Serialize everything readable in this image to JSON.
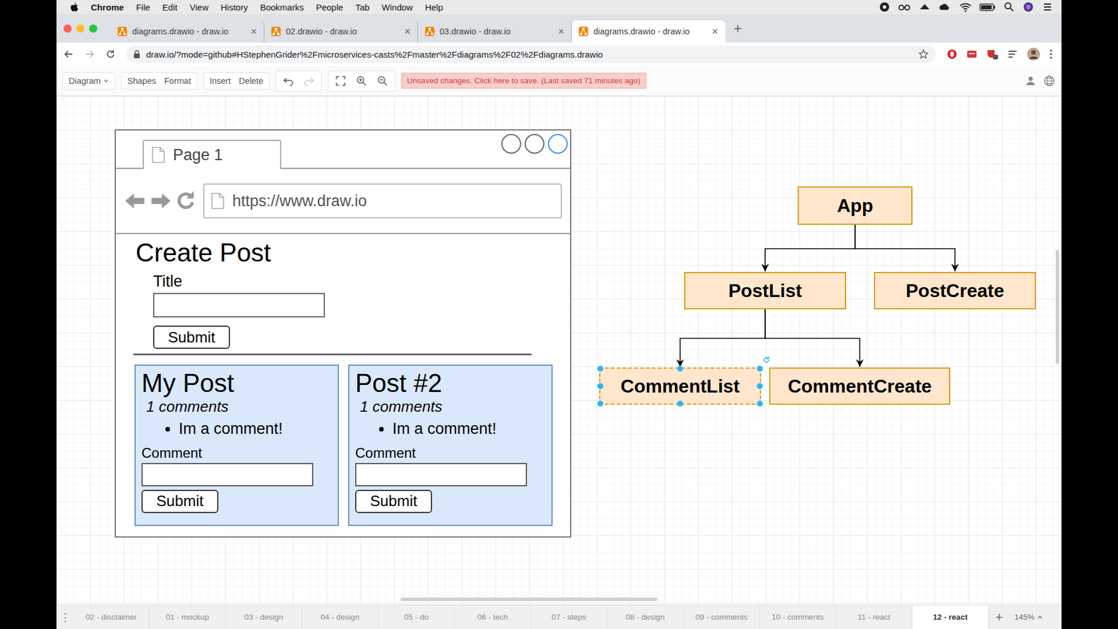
{
  "menubar": {
    "app": "Chrome",
    "items": [
      "File",
      "Edit",
      "View",
      "History",
      "Bookmarks",
      "People",
      "Tab",
      "Window",
      "Help"
    ]
  },
  "browser_tabs": [
    {
      "title": "diagrams.drawio - draw.io",
      "close": "×",
      "selected": false
    },
    {
      "title": "02.drawio - draw.io",
      "close": "×",
      "selected": false
    },
    {
      "title": "03.drawio - draw.io",
      "close": "×",
      "selected": false
    },
    {
      "title": "diagrams.drawio - draw.io",
      "close": "×",
      "selected": true
    }
  ],
  "new_tab": "+",
  "address_bar": {
    "url": "draw.io/?mode=github#HStephenGrider%2Fmicroservices-casts%2Fmaster%2Fdiagrams%2F02%2Fdiagrams.drawio"
  },
  "toolbar": {
    "groups": [
      [
        {
          "label": "Diagram",
          "dropdown": true
        }
      ],
      [
        {
          "label": "Shapes",
          "dropdown": false
        },
        {
          "label": "Format",
          "dropdown": false
        }
      ],
      [
        {
          "label": "Insert",
          "dropdown": false
        },
        {
          "label": "Delete",
          "dropdown": false
        }
      ]
    ],
    "banner": "Unsaved changes. Click here to save. (Last saved 71 minutes ago)"
  },
  "mockup": {
    "tab": "Page 1",
    "window_buttons": [
      {
        "highlighted": false
      },
      {
        "highlighted": false
      },
      {
        "highlighted": true
      }
    ],
    "url": "https://www.draw.io",
    "heading": "Create Post",
    "field_label": "Title",
    "field_value": "",
    "button": "Submit",
    "posts": [
      {
        "title": "My Post",
        "comment_count": "1 comments",
        "comments": [
          "Im a comment!"
        ],
        "field_label": "Comment",
        "field_value": "",
        "button": "Submit"
      },
      {
        "title": "Post #2",
        "comment_count": "1 comments",
        "comments": [
          "Im a comment!"
        ],
        "field_label": "Comment",
        "field_value": "",
        "button": "Submit"
      }
    ]
  },
  "diagram": {
    "nodes": [
      {
        "label": "App",
        "selected": false
      },
      {
        "label": "PostList",
        "selected": false
      },
      {
        "label": "PostCreate",
        "selected": false
      },
      {
        "label": "CommentList",
        "selected": true
      },
      {
        "label": "CommentCreate",
        "selected": false
      }
    ],
    "edges": [
      {
        "from": "App",
        "to": "PostList"
      },
      {
        "from": "App",
        "to": "PostCreate"
      },
      {
        "from": "PostList",
        "to": "CommentList"
      },
      {
        "from": "PostList",
        "to": "CommentCreate"
      }
    ]
  },
  "page_menu": "⋮",
  "page_tabs": [
    {
      "label": "02 - disclaimer",
      "selected": false
    },
    {
      "label": "01 - mockup",
      "selected": false
    },
    {
      "label": "03 - design",
      "selected": false
    },
    {
      "label": "04 - design",
      "selected": false
    },
    {
      "label": "05 - do",
      "selected": false
    },
    {
      "label": "06 - tech",
      "selected": false
    },
    {
      "label": "07 - steps",
      "selected": false
    },
    {
      "label": "08 - design",
      "selected": false
    },
    {
      "label": "09 - comments",
      "selected": false
    },
    {
      "label": "10 - comments",
      "selected": false
    },
    {
      "label": "11 - react",
      "selected": false
    },
    {
      "label": "12 - react",
      "selected": true
    }
  ],
  "add_page": "+",
  "zoom": "145%"
}
